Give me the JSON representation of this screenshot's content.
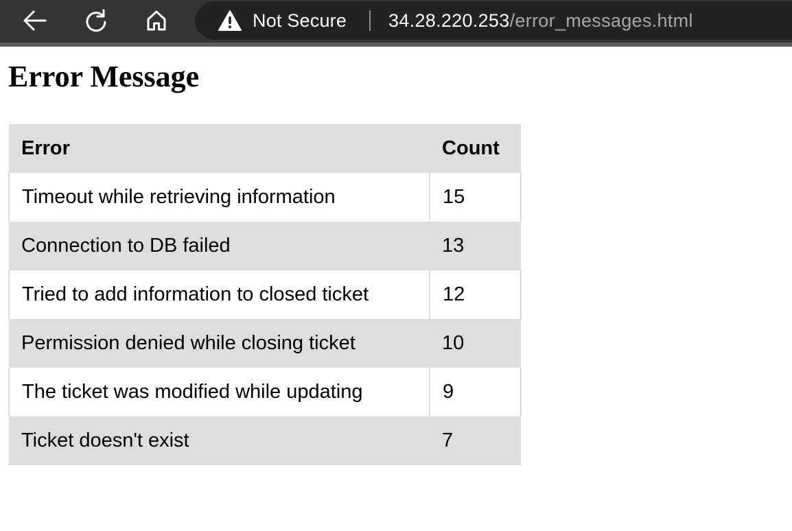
{
  "browser": {
    "security_label": "Not Secure",
    "url_host": "34.28.220.253",
    "url_path": "/error_messages.html",
    "icons": [
      "back-arrow-icon",
      "reload-icon",
      "home-icon",
      "warning-icon"
    ],
    "colors": {
      "toolbar": "#353535",
      "omnibox": "#232323",
      "url_host": "#ffffff",
      "url_path": "#a7a7a7"
    }
  },
  "page": {
    "title": "Error Message"
  },
  "table": {
    "headers": [
      "Error",
      "Count"
    ],
    "rows": [
      [
        "Timeout while retrieving information",
        "15"
      ],
      [
        "Connection to DB failed",
        "13"
      ],
      [
        "Tried to add information to closed ticket",
        "12"
      ],
      [
        "Permission denied while closing ticket",
        "10"
      ],
      [
        "The ticket was modified while updating",
        "9"
      ],
      [
        "Ticket doesn't exist",
        "7"
      ]
    ],
    "colors": {
      "header_bg": "#dddddd",
      "stripe_bg": "#dddddd",
      "row_bg": "#ffffff"
    }
  }
}
